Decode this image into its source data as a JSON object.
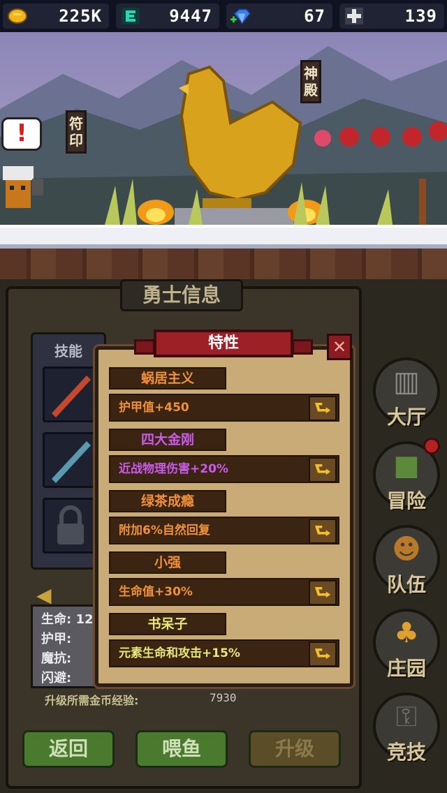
{
  "resources": {
    "gold": "225K",
    "energy": "9447",
    "gems": "67",
    "cross": "139"
  },
  "scene": {
    "sign_left": "符印",
    "sign_right": "神殿",
    "alert": "!"
  },
  "panel": {
    "title": "勇士信息",
    "skills_label": "技能",
    "stats": {
      "life_label": "生命:",
      "life_value": "12",
      "armor_label": "护甲:",
      "magic_res_label": "魔抗:",
      "dodge_label": "闪避:"
    },
    "upgrade_cost_label": "升级所需金币经验:",
    "upgrade_cost_value": "7930"
  },
  "bottom_buttons": {
    "back": "返回",
    "feed": "喂鱼",
    "upgrade": "升级"
  },
  "nav": {
    "hall": "大厅",
    "adventure": "冒险",
    "team": "队伍",
    "manor": "庄园",
    "arena": "竞技"
  },
  "modal": {
    "title": "特性",
    "close": "✕",
    "traits": [
      {
        "name": "蜗居主义",
        "desc": "护甲值+450",
        "name_color": "#f0913a",
        "desc_color": "#f0913a"
      },
      {
        "name": "四大金刚",
        "desc": "近战物理伤害+20%",
        "name_color": "#c85ce8",
        "desc_color": "#c85ce8"
      },
      {
        "name": "绿茶成瘾",
        "desc": "附加6%自然回复",
        "name_color": "#f0913a",
        "desc_color": "#f0913a"
      },
      {
        "name": "小强",
        "desc": "生命值+30%",
        "name_color": "#f0913a",
        "desc_color": "#f0913a"
      },
      {
        "name": "书呆子",
        "desc": "元素生命和攻击+15%",
        "name_color": "#e8e87a",
        "desc_color": "#e8e87a"
      }
    ]
  }
}
